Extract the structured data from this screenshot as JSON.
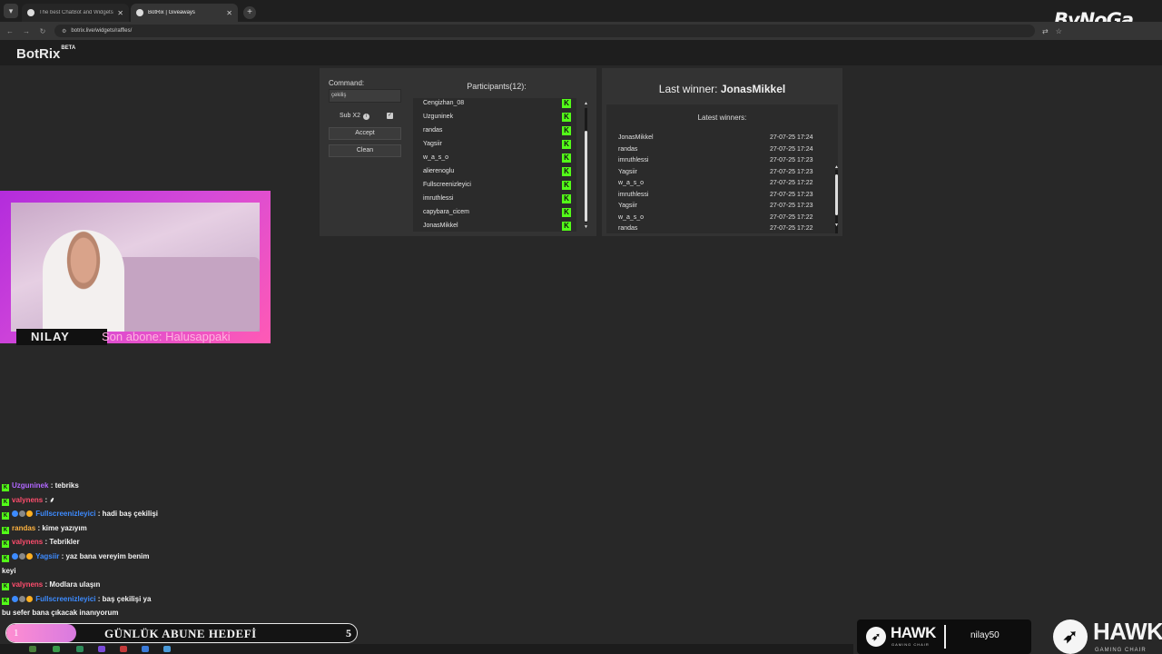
{
  "browser": {
    "tabs": [
      {
        "title": "The best ChatBot and Widgets",
        "active": false
      },
      {
        "title": "BotRix | Giveaways",
        "active": true
      }
    ],
    "url": "botrix.live/widgets/raffles/",
    "watermark": "ByNoGa"
  },
  "app": {
    "logo": "BotRix",
    "logo_badge": "BETA"
  },
  "raffle": {
    "command_label": "Command:",
    "command_value": "çekiliş",
    "sub_label": "Sub X2",
    "sub_checked": true,
    "accept_label": "Accept",
    "clean_label": "Clean",
    "participants_title": "Participants(12):",
    "participants": [
      "Cengizhan_08",
      "Uzguninek",
      "randas",
      "Yagsiir",
      "w_a_s_o",
      "alierenoglu",
      "Fullscreenizleyici",
      "imruthlessi",
      "capybara_cicem",
      "JonasMikkel"
    ]
  },
  "winners": {
    "last_winner_label": "Last winner:",
    "last_winner_name": "JonasMikkel",
    "latest_title": "Latest winners:",
    "list": [
      {
        "name": "JonasMikkel",
        "time": "27-07-25 17:24"
      },
      {
        "name": "randas",
        "time": "27-07-25 17:24"
      },
      {
        "name": "imruthlessi",
        "time": "27-07-25 17:23"
      },
      {
        "name": "Yagsiir",
        "time": "27-07-25 17:23"
      },
      {
        "name": "w_a_s_o",
        "time": "27-07-25 17:22"
      },
      {
        "name": "imruthlessi",
        "time": "27-07-25 17:23"
      },
      {
        "name": "Yagsiir",
        "time": "27-07-25 17:23"
      },
      {
        "name": "w_a_s_o",
        "time": "27-07-25 17:22"
      },
      {
        "name": "randas",
        "time": "27-07-25 17:22"
      }
    ]
  },
  "cam": {
    "name": "NILAY",
    "subscriber_ticker": "Son abone: Halusappaki"
  },
  "chat": [
    {
      "user": "Uzguninek",
      "color": "u1",
      "msg": ": tebriks"
    },
    {
      "user": "valynens",
      "color": "u2",
      "msg": ": ⸙"
    },
    {
      "user": "Fullscreenizleyici",
      "color": "u3",
      "msg": ": hadi baş çekilişi",
      "badges": true
    },
    {
      "user": "randas",
      "color": "u4",
      "msg": ": kime yazıyım"
    },
    {
      "user": "valynens",
      "color": "u2",
      "msg": ": Tebrikler"
    },
    {
      "user": "Yagsiir",
      "color": "u3",
      "msg": ": yaz bana vereyim benim",
      "badges": true,
      "cont": "keyi"
    },
    {
      "user": "valynens",
      "color": "u2",
      "msg": ": Modlara ulaşın"
    },
    {
      "user": "Fullscreenizleyici",
      "color": "u3",
      "msg": ": baş çekilişi ya",
      "badges": true,
      "cont": "bu sefer bana çıkacak inanıyorum"
    }
  ],
  "goal": {
    "current": "1",
    "label": "GÜNLÜK ABUNE HEDEFİ",
    "target": "5",
    "progress": 0.2
  },
  "sponsor": {
    "brand": "HAWK",
    "tagline": "GAMING CHAIR",
    "code": "nilay50"
  },
  "colors": {
    "kick_green": "#53fc18",
    "panel_bg": "#333333",
    "page_bg": "#282828",
    "cam_border": "#d54ad8"
  }
}
